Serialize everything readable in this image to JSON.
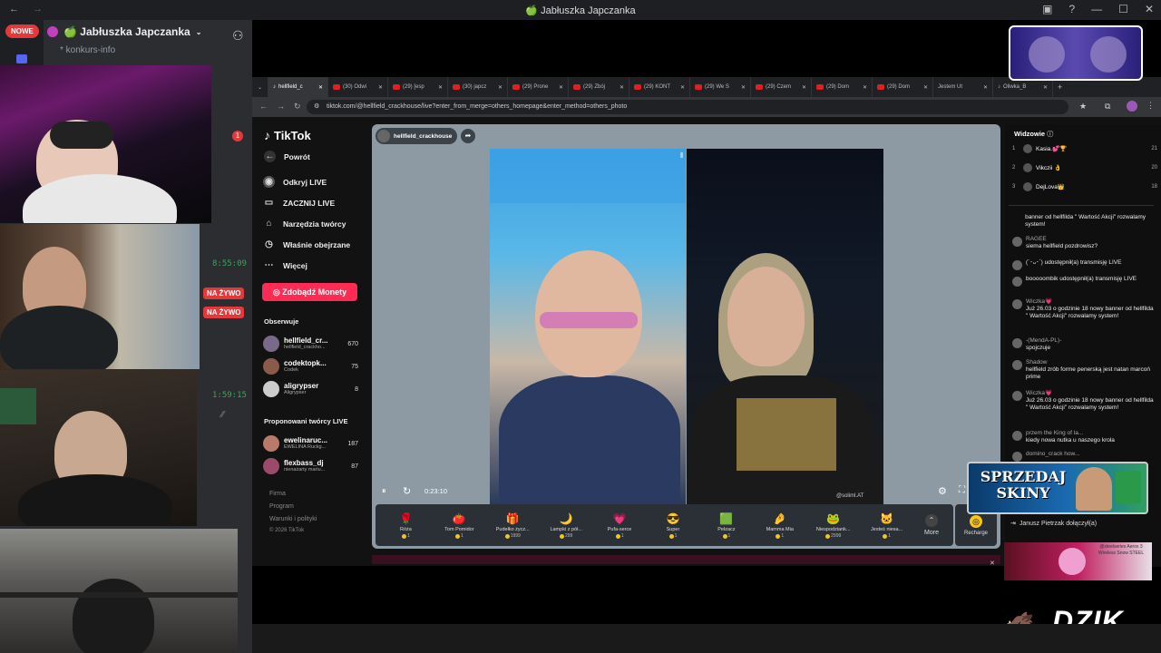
{
  "window": {
    "title": "🍏 Jabłuszka Japczanka"
  },
  "discord": {
    "nowe_label": "NOWE",
    "server_name": "🍏 Jabłuszka Japczanka",
    "channel_name": "* konkurs-info",
    "notification_count": "1",
    "timers": [
      "8:55:09",
      "1:59:15"
    ],
    "live_labels": [
      "NA ŻYWO",
      "NA ŻYWO"
    ]
  },
  "browser": {
    "tabs": [
      {
        "label": "hellfield_c",
        "active": true
      },
      {
        "label": "(30) Odwi"
      },
      {
        "label": "(29) [esp"
      },
      {
        "label": "(30) japcz"
      },
      {
        "label": "(29) Prone"
      },
      {
        "label": "(29) Zbój"
      },
      {
        "label": "(29) KONT"
      },
      {
        "label": "(29) We S"
      },
      {
        "label": "(29) Czem"
      },
      {
        "label": "(29) Dom"
      },
      {
        "label": "(29) Dom"
      },
      {
        "label": "Jestem Ut"
      },
      {
        "label": "Oliwka_B"
      }
    ],
    "url": "tiktok.com/@hellfield_crackhouse/live?enter_from_merge=others_homepage&enter_method=others_photo"
  },
  "tiktok": {
    "logo": "TikTok",
    "back": "Powrót",
    "menu": [
      {
        "label": "Odkryj LIVE",
        "icon": "live-icon"
      },
      {
        "label": "ZACZNIJ LIVE",
        "icon": "camera-icon"
      },
      {
        "label": "Narzędzia twórcy",
        "icon": "home-icon"
      },
      {
        "label": "Właśnie obejrzane",
        "icon": "history-icon"
      },
      {
        "label": "Więcej",
        "icon": "more-icon"
      }
    ],
    "coins_button": "Zdobądź Monety",
    "following_title": "Obserwuje",
    "following": [
      {
        "name": "hellfield_cr...",
        "sub": "hellfield_crackho...",
        "count": "670"
      },
      {
        "name": "codektopk...",
        "sub": "Codek",
        "count": "75"
      },
      {
        "name": "aligrypser",
        "sub": "Aligrypser",
        "count": "8"
      }
    ],
    "suggested_title": "Proponowani twórcy LIVE",
    "suggested": [
      {
        "name": "ewelinaruc...",
        "sub": "EWELINA Ruckg...",
        "count": "187"
      },
      {
        "name": "flexbass_dj",
        "sub": "nienażarty mariu...",
        "count": "87"
      }
    ],
    "footer": [
      "Firma",
      "Program",
      "Warunki i polityki",
      "© 2026 TikTok"
    ],
    "host": "hellfield_crackhouse",
    "elapsed": "0:23:10",
    "watermark": "@soliml.AT",
    "gifts": [
      {
        "name": "Róża",
        "price": "1",
        "icon": "🌹"
      },
      {
        "name": "Tom Pomidor",
        "price": "1",
        "icon": "🍅"
      },
      {
        "name": "Pudełko życz...",
        "price": "1999",
        "icon": "🎁"
      },
      {
        "name": "Lampki z pół...",
        "price": "299",
        "icon": "🌙"
      },
      {
        "name": "Pufa-serce",
        "price": "1",
        "icon": "💗"
      },
      {
        "name": "Super",
        "price": "1",
        "icon": "😎"
      },
      {
        "name": "Pełzacz",
        "price": "1",
        "icon": "🟩"
      },
      {
        "name": "Mamma Mia",
        "price": "1",
        "icon": "🤌"
      },
      {
        "name": "Niespodziank...",
        "price": "2999",
        "icon": "🐸"
      },
      {
        "name": "Jesteś niesa...",
        "price": "1",
        "icon": "🐱"
      }
    ],
    "more_label": "More",
    "recharge_label": "Recharge"
  },
  "chat": {
    "viewers_title": "Widzowie",
    "viewers": [
      {
        "rank": "1",
        "name": "Kasia.💕🏆",
        "score": "21"
      },
      {
        "rank": "2",
        "name": "Vikczii 👌",
        "score": "20"
      },
      {
        "rank": "3",
        "name": "DejLova👑",
        "score": "18"
      }
    ],
    "messages": [
      {
        "user": "",
        "text": "banner od hellfilda \" Wartość Akcji\" rozwalamy system!"
      },
      {
        "user": "RAGEE",
        "text": "siema hellfield pozdrowisz?"
      },
      {
        "user": "",
        "text": "(´･ᴗ･`) udostępnił(a) transmisję LIVE"
      },
      {
        "user": "",
        "text": "booooombik udostępnił(a) transmisję LIVE"
      },
      {
        "user": "Wiczka💗",
        "text": "Już 26.03 o godzinie 18 nowy banner od hellfilda \" Wartość Akcji\" rozwalamy system!"
      },
      {
        "user": "-(MendA-PL)-",
        "text": "spojczuje"
      },
      {
        "user": "Shadow",
        "text": "hellfield zrób forme penerską jest natan marcoń prime"
      },
      {
        "user": "Wiczka💗",
        "text": "Już 26.03 o godzinie 18 nowy banner od hellfilda \" Wartość Akcji\" rozwalamy system!"
      },
      {
        "user": "przem the King of la...",
        "text": "kiedy nowa nutka u naszego krola"
      },
      {
        "user": "domino_crack how...",
        "text": ""
      }
    ],
    "join": "Janusz Pietrzak dołączył(a)"
  },
  "overlays": {
    "sprzedaj": "SPRZEDAJ SKINY",
    "promo": "@steelseries Aerox 3 Wireless Snow STEEL",
    "brand": "DZIK"
  }
}
